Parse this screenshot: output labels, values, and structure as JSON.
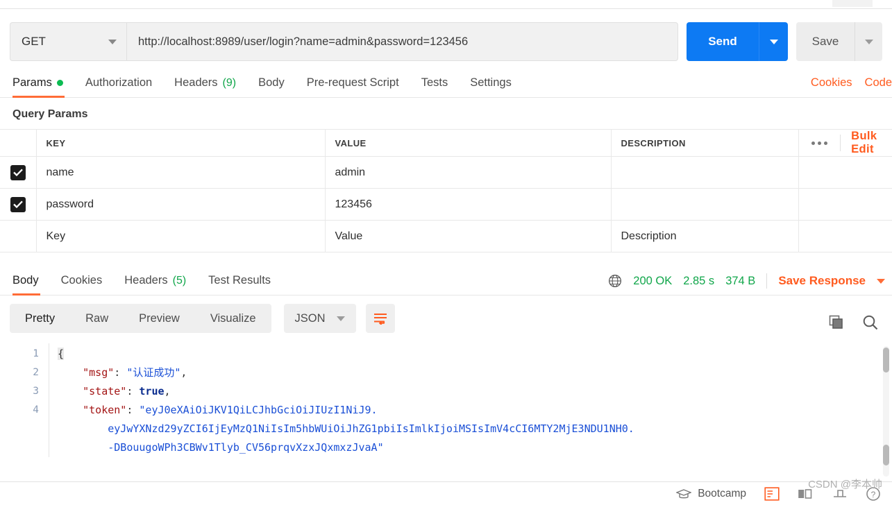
{
  "request": {
    "method": "GET",
    "url": "http://localhost:8989/user/login?name=admin&password=123456",
    "send_label": "Send",
    "save_label": "Save",
    "tabs": [
      {
        "label": "Params",
        "badge": "",
        "dot": true,
        "active": true
      },
      {
        "label": "Authorization",
        "badge": "",
        "dot": false,
        "active": false
      },
      {
        "label": "Headers",
        "badge": "(9)",
        "dot": false,
        "active": false
      },
      {
        "label": "Body",
        "badge": "",
        "dot": false,
        "active": false
      },
      {
        "label": "Pre-request Script",
        "badge": "",
        "dot": false,
        "active": false
      },
      {
        "label": "Tests",
        "badge": "",
        "dot": false,
        "active": false
      },
      {
        "label": "Settings",
        "badge": "",
        "dot": false,
        "active": false
      }
    ],
    "cookies_link": "Cookies",
    "code_link": "Code"
  },
  "query_params": {
    "title": "Query Params",
    "headers": {
      "key": "KEY",
      "value": "VALUE",
      "description": "DESCRIPTION"
    },
    "bulk_edit": "Bulk Edit",
    "rows": [
      {
        "checked": true,
        "key": "name",
        "value": "admin",
        "description": ""
      },
      {
        "checked": true,
        "key": "password",
        "value": "123456",
        "description": ""
      }
    ],
    "placeholder_row": {
      "key": "Key",
      "value": "Value",
      "description": "Description"
    }
  },
  "response": {
    "tabs": [
      {
        "label": "Body",
        "badge": "",
        "active": true
      },
      {
        "label": "Cookies",
        "badge": "",
        "active": false
      },
      {
        "label": "Headers",
        "badge": "(5)",
        "active": false
      },
      {
        "label": "Test Results",
        "badge": "",
        "active": false
      }
    ],
    "status": "200 OK",
    "time": "2.85 s",
    "size": "374 B",
    "save_response": "Save Response",
    "format_tabs": [
      {
        "label": "Pretty",
        "active": true
      },
      {
        "label": "Raw",
        "active": false
      },
      {
        "label": "Preview",
        "active": false
      },
      {
        "label": "Visualize",
        "active": false
      }
    ],
    "language": "JSON",
    "body_lines": [
      {
        "n": "1",
        "segments": [
          {
            "t": "{",
            "c": "tk-brace"
          }
        ]
      },
      {
        "n": "2",
        "segments": [
          {
            "t": "    ",
            "c": "tk-punc"
          },
          {
            "t": "\"msg\"",
            "c": "tk-key"
          },
          {
            "t": ": ",
            "c": "tk-punc"
          },
          {
            "t": "\"认证成功\"",
            "c": "tk-str"
          },
          {
            "t": ",",
            "c": "tk-punc"
          }
        ]
      },
      {
        "n": "3",
        "segments": [
          {
            "t": "    ",
            "c": "tk-punc"
          },
          {
            "t": "\"state\"",
            "c": "tk-key"
          },
          {
            "t": ": ",
            "c": "tk-punc"
          },
          {
            "t": "true",
            "c": "tk-bool"
          },
          {
            "t": ",",
            "c": "tk-punc"
          }
        ]
      },
      {
        "n": "4",
        "segments": [
          {
            "t": "    ",
            "c": "tk-punc"
          },
          {
            "t": "\"token\"",
            "c": "tk-key"
          },
          {
            "t": ": ",
            "c": "tk-punc"
          },
          {
            "t": "\"eyJ0eXAiOiJKV1QiLCJhbGciOiJIUzI1NiJ9.",
            "c": "tk-str"
          }
        ]
      },
      {
        "n": "",
        "segments": [
          {
            "t": "        eyJwYXNzd29yZCI6IjEyMzQ1NiIsIm5hbWUiOiJhZG1pbiIsImlkIjoiMSIsImV4cCI6MTY2MjE3NDU1NH0.",
            "c": "tk-str"
          }
        ]
      },
      {
        "n": "",
        "segments": [
          {
            "t": "        -DBouugoWPh3CBWv1Tlyb_CV56prqvXzxJQxmxzJvaA\"",
            "c": "tk-str"
          }
        ]
      }
    ]
  },
  "bottom": {
    "bootcamp": "Bootcamp"
  },
  "watermark": "CSDN @李本帅",
  "colors": {
    "accent_orange": "#ff5b1f",
    "send_blue": "#0d7af3",
    "status_green": "#10a64a"
  }
}
